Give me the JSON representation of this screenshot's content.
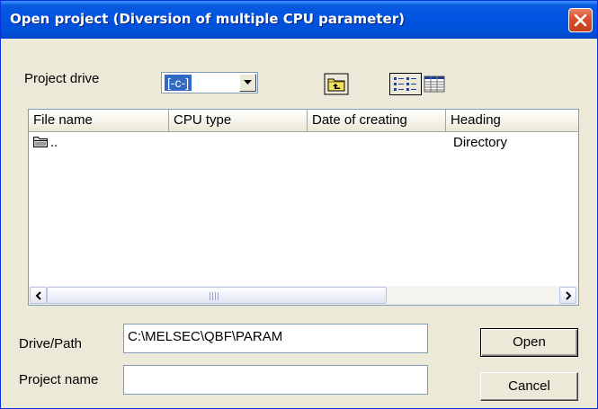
{
  "window": {
    "title": "Open project (Diversion of multiple CPU parameter)"
  },
  "project_drive": {
    "label": "Project drive",
    "selected": "[-c-]"
  },
  "toolbar": {
    "up_folder_icon": "folder-up-icon",
    "list_view_icon": "list-view-icon",
    "details_view_icon": "details-view-icon"
  },
  "file_list": {
    "columns": [
      "File name",
      "CPU type",
      "Date of creating",
      "Heading"
    ],
    "rows": [
      {
        "icon": "folder-icon",
        "name": "..",
        "cpu_type": "",
        "date": "",
        "heading": "Directory"
      }
    ],
    "scrollbar_grip": "III"
  },
  "drive_path": {
    "label": "Drive/Path",
    "value": "C:\\MELSEC\\QBF\\PARAM"
  },
  "project_name": {
    "label": "Project name",
    "value": ""
  },
  "buttons": {
    "open": "Open",
    "cancel": "Cancel"
  },
  "colors": {
    "titlebar": "#0054e3",
    "dialog_bg": "#ece9d8",
    "close_button": "#d8502c",
    "selection": "#316ac5"
  }
}
